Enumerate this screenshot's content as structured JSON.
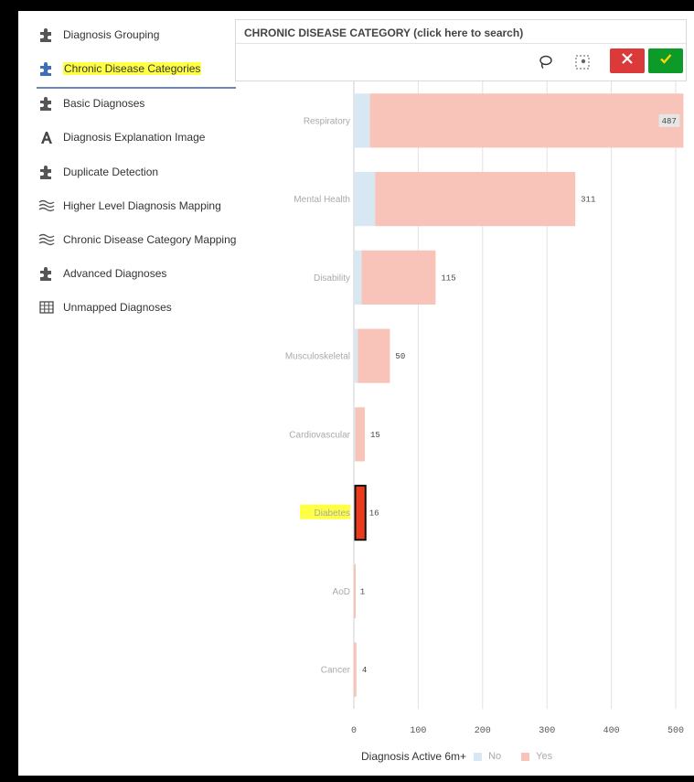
{
  "sidebar": {
    "items": [
      {
        "label": "Diagnosis Grouping",
        "icon": "puzzle-icon"
      },
      {
        "label": "Chronic Disease Categories",
        "icon": "puzzle-icon",
        "selected": true
      },
      {
        "label": "Basic Diagnoses",
        "icon": "puzzle-icon"
      },
      {
        "label": "Diagnosis Explanation Image",
        "icon": "text-a-icon"
      },
      {
        "label": "Duplicate Detection",
        "icon": "puzzle-icon"
      },
      {
        "label": "Higher Level Diagnosis Mapping",
        "icon": "wave-lines-icon"
      },
      {
        "label": "Chronic Disease Category Mapping",
        "icon": "wave-lines-icon"
      },
      {
        "label": "Advanced Diagnoses",
        "icon": "puzzle-icon"
      },
      {
        "label": "Unmapped Diagnoses",
        "icon": "table-icon"
      }
    ]
  },
  "search": {
    "title": "CHRONIC DISEASE CATEGORY (click here to search)",
    "lasso_icon": "lasso-icon",
    "rect_icon": "rect-select-icon",
    "cancel_icon": "close-icon",
    "confirm_icon": "check-icon"
  },
  "colors": {
    "no": "#d7e8f3",
    "yes": "#f8c3b8",
    "selected_fill": "#ec3a1c",
    "selected_outline": "#111111",
    "highlight": "#ffff44",
    "grid": "#e2e2e2"
  },
  "chart_data": {
    "type": "bar",
    "orientation": "horizontal",
    "stacked": true,
    "categories": [
      "Respiratory",
      "Mental Health",
      "Disability",
      "Musculoskeletal",
      "Cardiovascular",
      "Diabetes",
      "AoD",
      "Cancer"
    ],
    "series": [
      {
        "name": "No",
        "values": [
          25,
          33,
          12,
          6,
          2,
          0,
          0,
          0
        ]
      },
      {
        "name": "Yes",
        "values": [
          487,
          311,
          115,
          50,
          15,
          16,
          1,
          4
        ]
      }
    ],
    "value_labels": [
      "487",
      "311",
      "115",
      "50",
      "15",
      "16",
      "1",
      "4"
    ],
    "selected_category": "Diabetes",
    "xlim": [
      0,
      500
    ],
    "xticks": [
      0,
      100,
      200,
      300,
      400,
      500
    ],
    "legend_title": "Diagnosis Active 6m+",
    "legend_position": "bottom",
    "grid": true
  }
}
